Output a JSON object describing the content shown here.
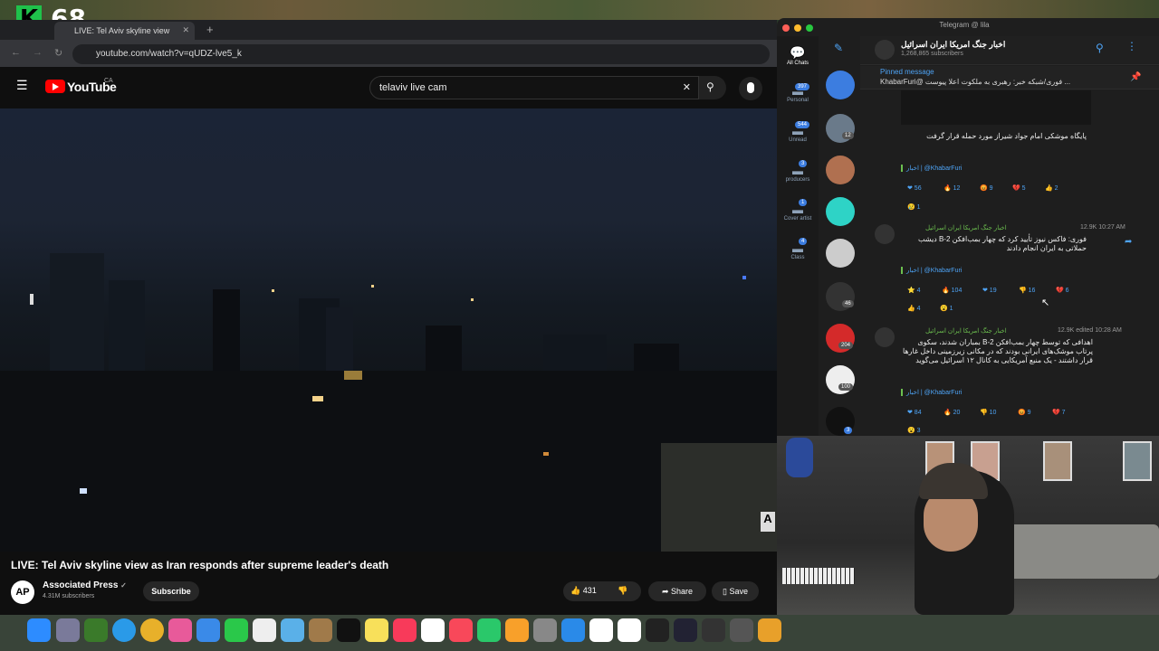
{
  "overlay": {
    "logo": "K",
    "count": "68"
  },
  "browser": {
    "tab_title": "LIVE: Tel Aviv skyline view",
    "url": "youtube.com/watch?v=qUDZ-lve5_k"
  },
  "youtube": {
    "logo": "YouTube",
    "region": "CA",
    "search_value": "telaviv live cam",
    "video_title": "LIVE: Tel Aviv skyline view as Iran responds after supreme leader's death",
    "channel": "Associated Press",
    "channel_avatar": "AP",
    "subscribers": "4.31M subscribers",
    "subscribe_label": "Subscribe",
    "likes": "431",
    "share_label": "Share",
    "save_label": "Save"
  },
  "telegram": {
    "window_title": "Telegram @ lila",
    "channel_name": "اخبار جنگ امریکا ایران اسرائیل",
    "channel_subs": "1,268,865 subscribers",
    "pinned_label": "Pinned message",
    "pinned_text": "KhabarFuri@ فوری/شبکه خبر: رهبری به ملکوت اعلا پیوست ...",
    "folders": [
      {
        "label": "All Chats"
      },
      {
        "label": "Personal",
        "badge": "397"
      },
      {
        "label": "Unread",
        "badge": "544"
      },
      {
        "label": "producers",
        "badge": "3"
      },
      {
        "label": "Cover artist",
        "badge": "1"
      },
      {
        "label": "Class",
        "badge": "4"
      }
    ],
    "chat_badges": [
      "12",
      "204",
      "100",
      "46",
      "3"
    ],
    "messages": [
      {
        "text": "پایگاه موشکی امام جواد شیراز مورد حمله قرار گرفت",
        "sig": "اخبار | @KhabarFuri",
        "reactions": [
          "❤ 56",
          "🔥 12",
          "😡 9",
          "💔 5",
          "👍 2",
          "😢 1"
        ]
      },
      {
        "fwd": "اخبار جنگ امریکا ایران اسرائیل",
        "meta": "12.9K 10:27 AM",
        "text": "فوری: فاکس نیوز تأیید کرد که چهار بمب‌افکن B-2 دیشب حملاتی به ایران انجام دادند",
        "sig": "اخبار | @KhabarFuri",
        "reactions": [
          "⭐ 4",
          "🔥 104",
          "❤ 19",
          "👎 16",
          "💔 6",
          "👍 4",
          "😮 1"
        ]
      },
      {
        "fwd": "اخبار جنگ امریکا ایران اسرائیل",
        "meta": "12.9K edited 10:28 AM",
        "text": "اهدافی که توسط چهار بمب‌افکن B-2 بمباران شدند، سکوی پرتاب موشک‌های ایرانی بودند که در مکانی زیرزمینی داخل غارها قرار داشتند - یک منبع آمریکایی به کانال ۱۲ اسرائیل می‌گوید",
        "sig": "اخبار | @KhabarFuri",
        "reactions": [
          "❤ 84",
          "🔥 20",
          "👎 10",
          "😡 9",
          "💔 7",
          "😮 3"
        ]
      }
    ]
  }
}
